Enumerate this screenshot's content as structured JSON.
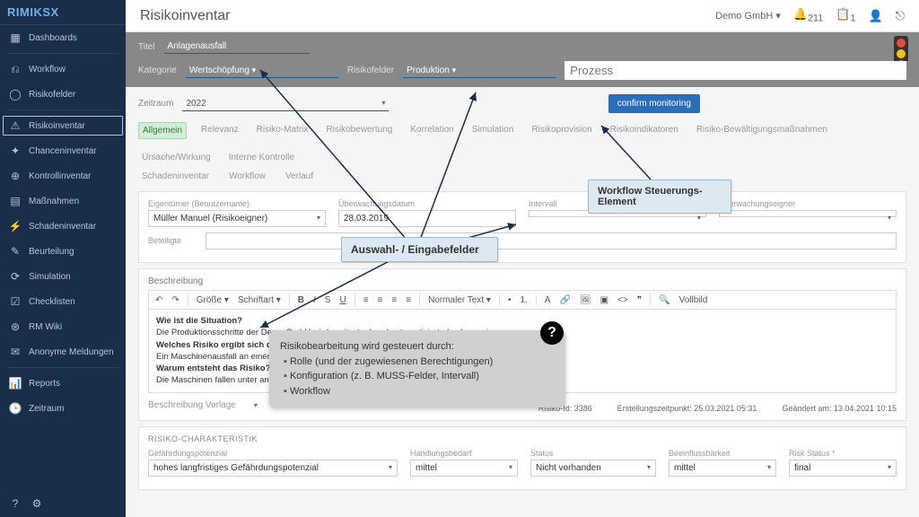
{
  "brand": "RIMIKSX",
  "nav": {
    "dashboards": "Dashboards",
    "workflow": "Workflow",
    "risikofelder": "Risikofelder",
    "risikoinventar": "Risikoinventar",
    "chanceninventar": "Chanceninventar",
    "kontrollinventar": "Kontrollinventar",
    "massnahmen": "Maßnahmen",
    "schadeninventar": "Schadeninventar",
    "beurteilung": "Beurteilung",
    "simulation": "Simulation",
    "checklisten": "Checklisten",
    "rmwiki": "RM Wiki",
    "anonyme": "Anonyme Meldungen",
    "reports": "Reports",
    "zeitraum": "Zeitraum"
  },
  "header": {
    "title": "Risikoinventar",
    "tenant": "Demo GmbH",
    "bell_count": "211",
    "clip_count": "1"
  },
  "riskbar": {
    "titel_label": "Titel",
    "titel": "Anlagenausfall",
    "kategorie_label": "Kategorie",
    "kategorie": "Wertschöpfung",
    "risikofelder_label": "Risikofelder",
    "risikofelder": "Produktion",
    "prozess_placeholder": "Prozess"
  },
  "period": {
    "label": "Zeitraum",
    "value": "2022",
    "confirm": "confirm monitoring"
  },
  "tabs": [
    "Allgemein",
    "Relevanz",
    "Risiko-Matrix",
    "Risikobewertung",
    "Korrelation",
    "Simulation",
    "Risikoprovision",
    "Risikoindikatoren",
    "Risiko-Bewältigungsmaßnahmen",
    "Ursache/Wirkung",
    "Interne Kontrolle"
  ],
  "subtabs": [
    "Schadeninventar",
    "Workflow",
    "Verlauf"
  ],
  "form": {
    "owner_label": "Eigentümer (Benutzername)",
    "owner": "Müller Manuel (Risikoeigner)",
    "ueberwachung_label": "Überwachungsdatum",
    "ueberwachung": "28.03.2019",
    "intervall_label": "Intervall",
    "eigner_label": "Überwachungseigner",
    "beteiligte_label": "Beteiligte"
  },
  "desc": {
    "section": "Beschreibung",
    "size": "Größe",
    "font": "Schriftart",
    "normal": "Normaler Text",
    "vollbild": "Vollbild",
    "q1": "Wie ist die Situation?",
    "a1": "Die Produktionsschritte der Demo GmbH wird, weitestgehend automatisiert, durch voneina",
    "q2": "Welches Risiko ergibt sich daraus?",
    "a2": "Ein Maschinenausfall an einer oder mehreren Stellen der Produktionskette führt zum Stillst",
    "q3": "Warum entsteht das Risiko?",
    "a3": "Die Maschinen fallen unter anderem aufgrund von Verschleißerscheinungen, technischen Fe",
    "vorlage": "Beschreibung Vorlage"
  },
  "meta": {
    "id": "Risiko-Id: 3386",
    "created": "Erstellungszeitpunkt: 25.03.2021 05:31",
    "changed": "Geändert am: 13.04.2021 10:15"
  },
  "char": {
    "title": "RISIKO-CHARAKTERISTIK",
    "gefahr_label": "Gefährdungspotenzial",
    "gefahr": "hohes langfristiges Gefährdungspotenzial",
    "handlung_label": "Handlungsbedarf",
    "handlung": "mittel",
    "status_label": "Status",
    "status": "Nicht vorhanden",
    "beeinfluss_label": "Beeinflussbarkeit",
    "beeinfluss": "mittel",
    "riskstatus_label": "Risk Status *",
    "riskstatus": "final"
  },
  "callouts": {
    "workflow": "Workflow Steuerungs-Element",
    "auswahl": "Auswahl- / Eingabefelder",
    "info_title": "Risikobearbeitung wird gesteuert durch:",
    "info_items": [
      "Rolle (und der zugewiesenen Berechtigungen)",
      "Konfiguration (z. B. MUSS-Felder, Intervall)",
      "Workflow"
    ]
  }
}
